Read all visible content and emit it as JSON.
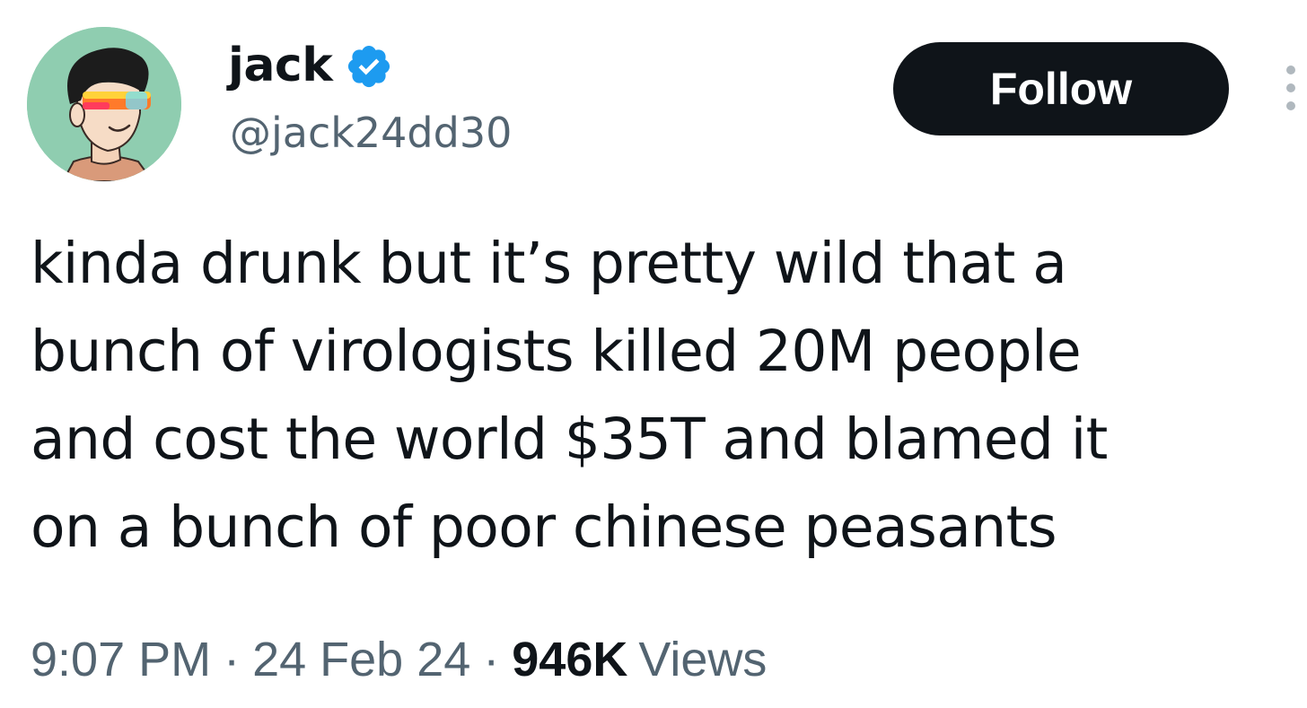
{
  "user": {
    "display_name": "jack",
    "handle": "@jack24dd30",
    "verified": true,
    "avatar_icon": "avatar-sunglasses-illustration",
    "verified_icon": "verified-badge-icon",
    "verified_color": "#1d9bf0"
  },
  "actions": {
    "follow_label": "Follow",
    "more_icon": "more-options-icon"
  },
  "tweet": {
    "text_lines": [
      "kinda drunk but it’s pretty wild that a",
      "bunch of virologists killed 20M people",
      "and cost the world $35T and blamed it",
      "on a bunch of poor chinese peasants"
    ]
  },
  "meta": {
    "time": "9:07 PM",
    "separator": "·",
    "date": "24 Feb 24",
    "views_count": "946K",
    "views_label": "Views"
  },
  "colors": {
    "text_primary": "#0f1419",
    "text_secondary": "#536471",
    "button_bg": "#0f1419",
    "button_text": "#ffffff",
    "avatar_bg": "#8fcdb0"
  }
}
